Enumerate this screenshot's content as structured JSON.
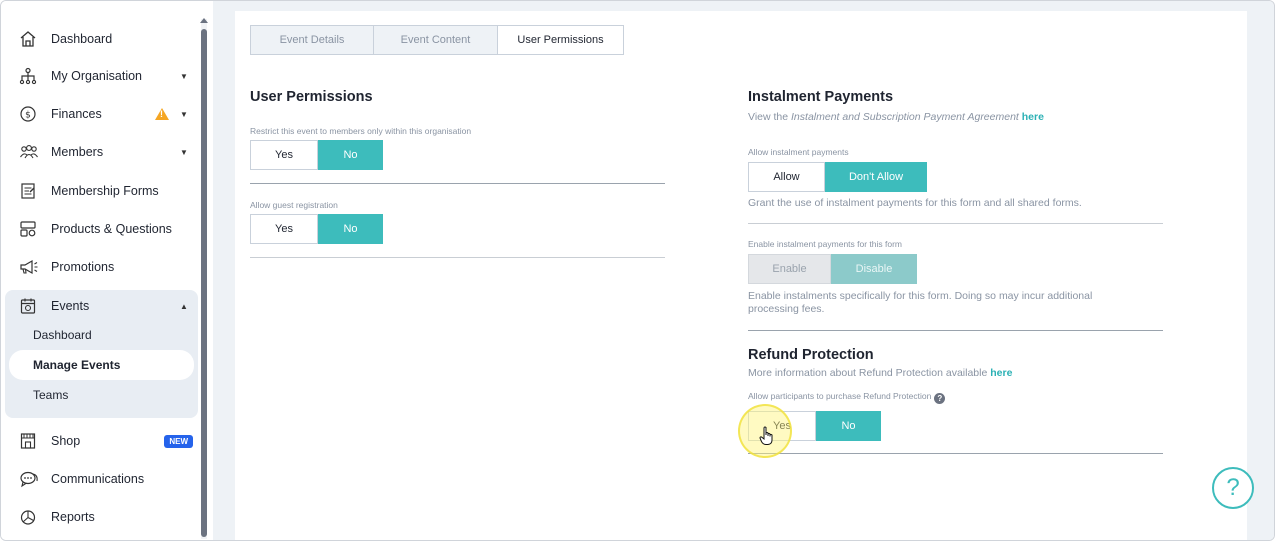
{
  "sidebar": {
    "items": [
      {
        "label": "Dashboard",
        "icon": "home-icon"
      },
      {
        "label": "My Organisation",
        "icon": "org-chart-icon"
      },
      {
        "label": "Finances",
        "icon": "dollar-circle-icon"
      },
      {
        "label": "Members",
        "icon": "members-icon"
      },
      {
        "label": "Membership Forms",
        "icon": "form-icon"
      },
      {
        "label": "Products & Questions",
        "icon": "products-icon"
      },
      {
        "label": "Promotions",
        "icon": "megaphone-icon"
      },
      {
        "label": "Events",
        "icon": "calendar-icon"
      },
      {
        "label": "Shop",
        "icon": "shop-icon",
        "badge": "NEW"
      },
      {
        "label": "Communications",
        "icon": "chat-icon"
      },
      {
        "label": "Reports",
        "icon": "pie-chart-icon"
      }
    ],
    "events_sub": [
      {
        "label": "Dashboard"
      },
      {
        "label": "Manage Events",
        "active": true
      },
      {
        "label": "Teams"
      }
    ]
  },
  "tabs": [
    {
      "label": "Event Details"
    },
    {
      "label": "Event Content"
    },
    {
      "label": "User Permissions",
      "active": true
    }
  ],
  "user_permissions": {
    "title": "User Permissions",
    "restrict_label": "Restrict this event to members only within this organisation",
    "restrict_yes": "Yes",
    "restrict_no": "No",
    "guest_label": "Allow guest registration",
    "guest_yes": "Yes",
    "guest_no": "No"
  },
  "instalment": {
    "title": "Instalment Payments",
    "view_prefix": "View the",
    "view_italic": "Instalment and Subscription Payment Agreement",
    "view_link": "here",
    "allow_label": "Allow instalment payments",
    "allow": "Allow",
    "dont_allow": "Don't Allow",
    "grant_text": "Grant the use of instalment payments for this form and all shared forms.",
    "enable_label": "Enable instalment payments for this form",
    "enable": "Enable",
    "disable": "Disable",
    "enable_desc": "Enable instalments specifically for this form. Doing so may incur additional processing fees."
  },
  "refund": {
    "title": "Refund Protection",
    "info_prefix": "More information about Refund Protection available",
    "info_link": "here",
    "allow_label": "Allow participants to purchase Refund Protection",
    "yes": "Yes",
    "no": "No"
  },
  "help": {
    "symbol": "?"
  },
  "colors": {
    "accent": "#3dbcbc",
    "warning": "#f5a623",
    "badge": "#2563eb"
  }
}
